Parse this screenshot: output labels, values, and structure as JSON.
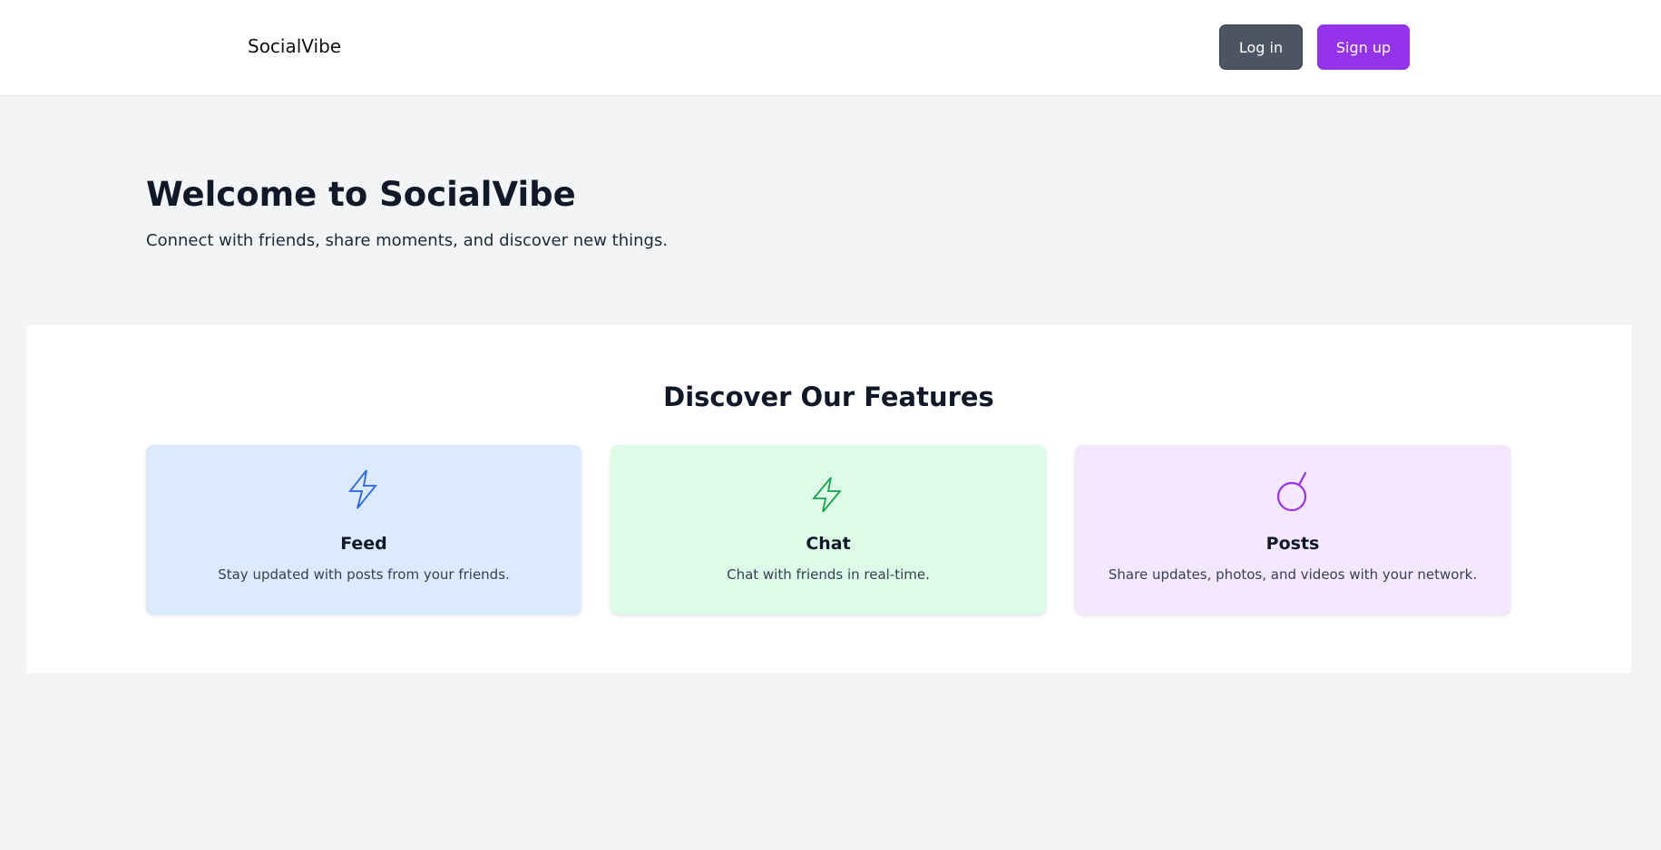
{
  "header": {
    "brand": "SocialVibe",
    "login_label": "Log in",
    "signup_label": "Sign up"
  },
  "hero": {
    "title": "Welcome to SocialVibe",
    "subtitle": "Connect with friends, share moments, and discover new things."
  },
  "features": {
    "title": "Discover Our Features",
    "cards": [
      {
        "icon": "lightning-bolt-icon",
        "title": "Feed",
        "description": "Stay updated with posts from your friends.",
        "background": "#dbeafe",
        "icon_color": "#2563eb"
      },
      {
        "icon": "lightning-bolt-icon",
        "title": "Chat",
        "description": "Chat with friends in real-time.",
        "background": "#dcfce7",
        "icon_color": "#16a34a"
      },
      {
        "icon": "circle-stem-icon",
        "title": "Posts",
        "description": "Share updates, photos, and videos with your network.",
        "background": "#f3e8ff",
        "icon_color": "#9333ea"
      }
    ]
  },
  "colors": {
    "page_background": "#f3f4f6",
    "login_button": "#4b5563",
    "signup_button": "#9333ea"
  }
}
